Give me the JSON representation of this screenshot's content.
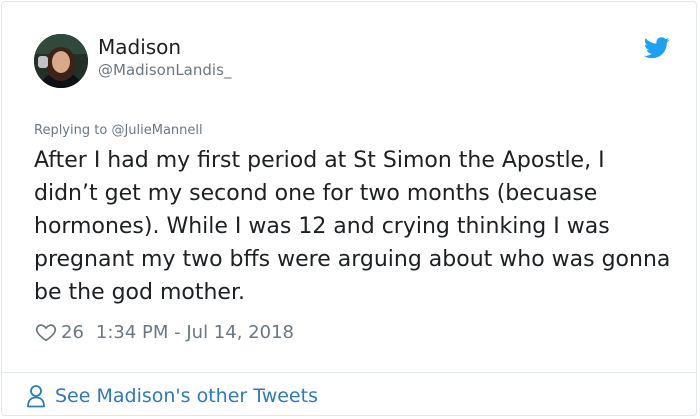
{
  "author": {
    "display_name": "Madison",
    "handle": "@MadisonLandis_"
  },
  "reply": {
    "prefix": "Replying to ",
    "mention": "@JulieMannell"
  },
  "tweet": {
    "text": "After I had my first period at St Simon the Apostle, I didn’t get my second one for two months (becuase hormones). While I was 12 and crying thinking I was pregnant my two bffs were arguing about who was gonna be the god mother.",
    "like_count": "26",
    "timestamp": "1:34 PM - Jul 14, 2018"
  },
  "footer": {
    "see_more_label": "See Madison's other Tweets"
  },
  "icons": {
    "brand": "twitter-bird-icon",
    "like": "heart-icon",
    "profile": "person-icon"
  },
  "colors": {
    "twitter_blue": "#1da1f2",
    "link_blue": "#2b7bb9",
    "secondary_text": "#697882",
    "primary_text": "#1c2022",
    "border": "#e1e8ed"
  }
}
